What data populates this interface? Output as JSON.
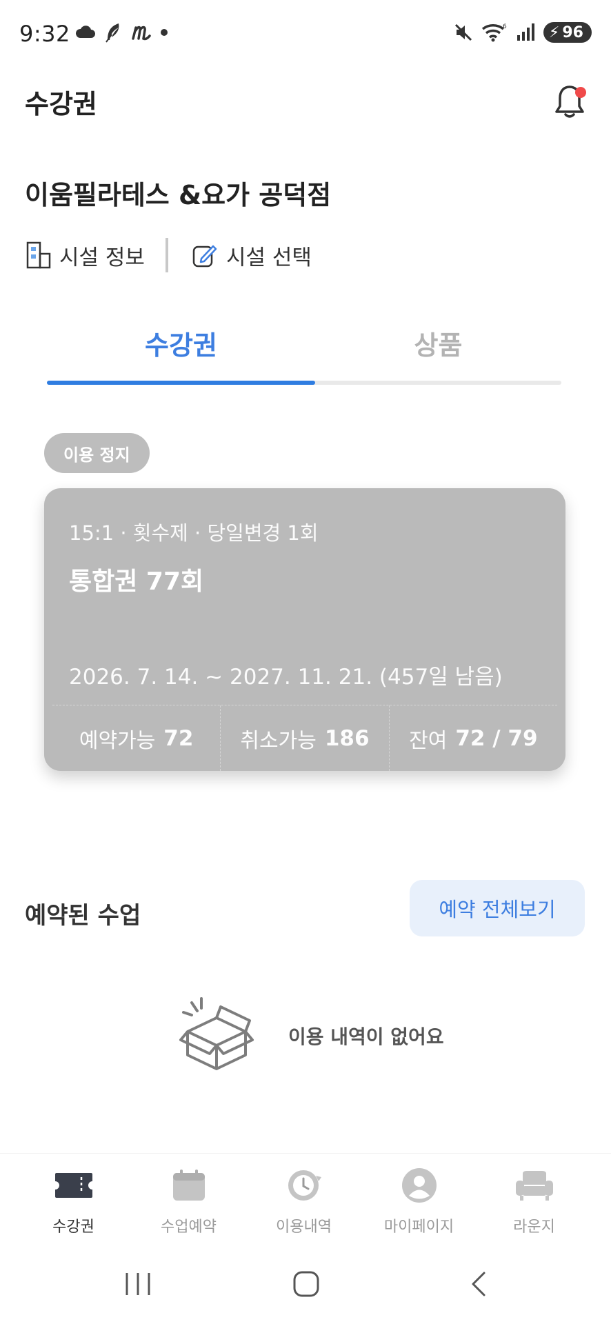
{
  "status_bar": {
    "time": "9:32",
    "battery": "96",
    "icons": [
      "cloud-icon",
      "feather-icon",
      "m-app-icon",
      "dot-icon",
      "mute-icon",
      "wifi-icon",
      "signal-icon",
      "battery-icon"
    ]
  },
  "header": {
    "title": "수강권",
    "notification_icon": "bell-icon",
    "has_unread": true
  },
  "facility": {
    "name": "이움필라테스 &요가 공덕점",
    "info_label": "시설 정보",
    "select_label": "시설 선택"
  },
  "tabs": {
    "items": [
      {
        "label": "수강권",
        "active": true
      },
      {
        "label": "상품",
        "active": false
      }
    ]
  },
  "pass": {
    "status": "이용 정지",
    "meta": "15:1 · 횟수제 · 당일변경 1회",
    "name": "통합권 77회",
    "period": "2026. 7. 14. ~ 2027. 11. 21. (457일 남음)",
    "stats": [
      {
        "label": "예약가능",
        "value": "72"
      },
      {
        "label": "취소가능",
        "value": "186"
      },
      {
        "label": "잔여",
        "value": "72 / 79"
      }
    ]
  },
  "reserved": {
    "title": "예약된 수업",
    "view_all": "예약 전체보기",
    "empty_message": "이용 내역이 없어요",
    "empty_icon": "open-box-icon"
  },
  "bottom_nav": {
    "items": [
      {
        "label": "수강권",
        "icon": "ticket-icon",
        "active": true
      },
      {
        "label": "수업예약",
        "icon": "calendar-icon",
        "active": false
      },
      {
        "label": "이용내역",
        "icon": "history-clock-icon",
        "active": false
      },
      {
        "label": "마이페이지",
        "icon": "user-icon",
        "active": false
      },
      {
        "label": "라운지",
        "icon": "armchair-icon",
        "active": false
      }
    ]
  },
  "colors": {
    "accent": "#2f7de1",
    "accent_text": "#3d7ee0",
    "card_inactive": "#bababa",
    "badge_red": "#f04a4a"
  }
}
